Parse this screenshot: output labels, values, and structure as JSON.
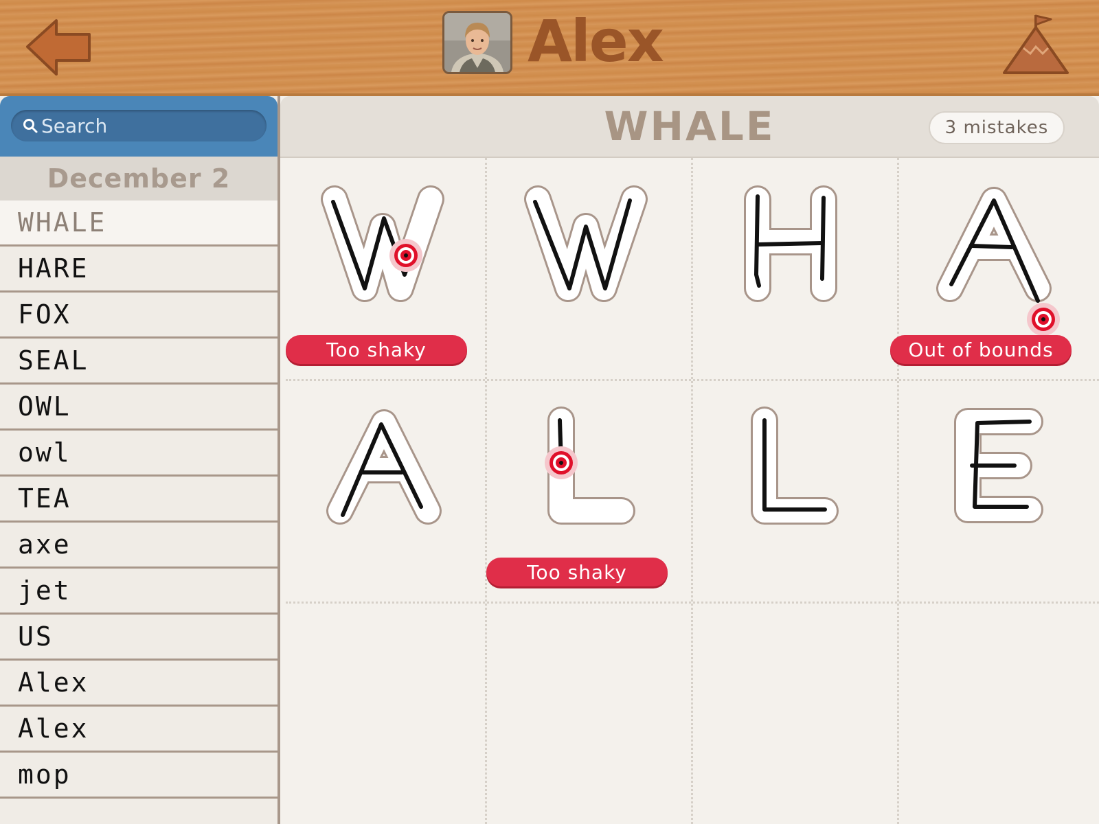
{
  "header": {
    "profile_name": "Alex",
    "back_icon": "back-arrow-icon",
    "home_icon": "mountain-flag-icon"
  },
  "sidebar": {
    "search_placeholder": "Search",
    "date": "December 2",
    "words": [
      "WHALE",
      "HARE",
      "FOX",
      "SEAL",
      "OWL",
      "owl",
      "TEA",
      "axe",
      "jet",
      "US",
      "Alex",
      "Alex",
      "mop"
    ],
    "selected_index": 0
  },
  "main": {
    "word_title": "WHALE",
    "mistakes": "3 mistakes",
    "letters": [
      {
        "letter": "W",
        "error": "Too shaky"
      },
      {
        "letter": "W",
        "error": ""
      },
      {
        "letter": "H",
        "error": ""
      },
      {
        "letter": "A",
        "error": "Out of bounds"
      },
      {
        "letter": "A",
        "error": ""
      },
      {
        "letter": "L",
        "error": "Too shaky"
      },
      {
        "letter": "L",
        "error": ""
      },
      {
        "letter": "E",
        "error": ""
      }
    ]
  },
  "colors": {
    "wood": "#d49354",
    "accent_text": "#9a5528",
    "search_blue": "#4a86b8",
    "error_red": "#e02e49"
  }
}
